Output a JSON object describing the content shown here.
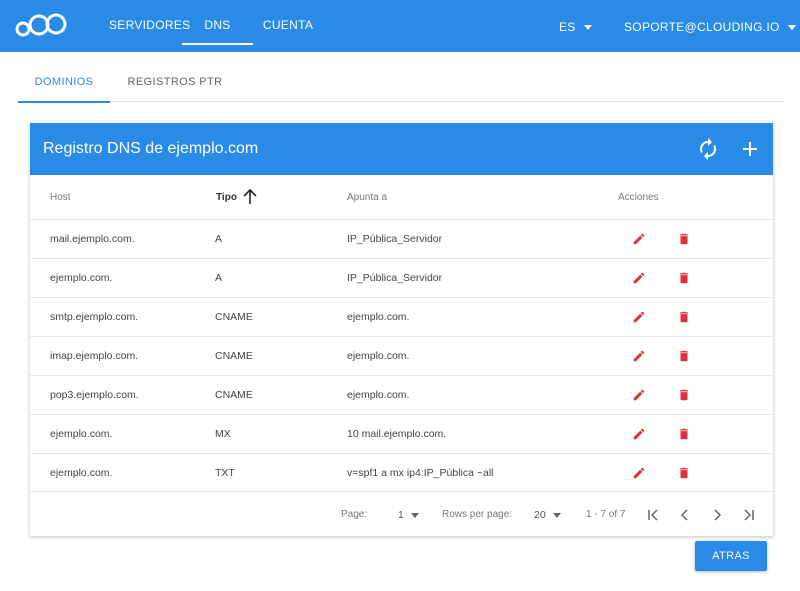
{
  "topnav": {
    "logo": "clouding-logo",
    "items": [
      {
        "label": "SERVIDORES",
        "active": false
      },
      {
        "label": "DNS",
        "active": true
      },
      {
        "label": "CUENTA",
        "active": false
      }
    ],
    "language": "ES",
    "account": "SOPORTE@CLOUDING.IO"
  },
  "tabs": [
    {
      "label": "DOMINIOS",
      "active": true
    },
    {
      "label": "REGISTROS PTR",
      "active": false
    }
  ],
  "card": {
    "title": "Registro DNS de ejemplo.com",
    "refresh_icon": "refresh-icon",
    "add_icon": "add-icon"
  },
  "table": {
    "headers": {
      "host": "Host",
      "tipo": "Tipo",
      "apunta": "Apunta a",
      "acciones": "Acciones"
    },
    "rows": [
      {
        "host": "mail.ejemplo.com.",
        "tipo": "A",
        "apunta": "IP_Pública_Servidor"
      },
      {
        "host": "ejemplo.com.",
        "tipo": "A",
        "apunta": "IP_Pública_Servidor"
      },
      {
        "host": "smtp.ejemplo.com.",
        "tipo": "CNAME",
        "apunta": "ejemplo.com."
      },
      {
        "host": "imap.ejemplo.com.",
        "tipo": "CNAME",
        "apunta": "ejemplo.com."
      },
      {
        "host": "pop3.ejemplo.com.",
        "tipo": "CNAME",
        "apunta": "ejemplo.com."
      },
      {
        "host": "ejemplo.com.",
        "tipo": "MX",
        "apunta": "10 mail.ejemplo.com."
      },
      {
        "host": "ejemplo.com.",
        "tipo": "TXT",
        "apunta": "v=spf1 a mx ip4:IP_Pública ~all"
      }
    ]
  },
  "pagination": {
    "page_label": "Page:",
    "page_value": "1",
    "rows_label": "Rows per page:",
    "rows_value": "20",
    "range": "1 - 7 of 7"
  },
  "colors": {
    "primary": "#2a8be6",
    "danger": "#e0323c"
  },
  "back_button": "ATRAS"
}
